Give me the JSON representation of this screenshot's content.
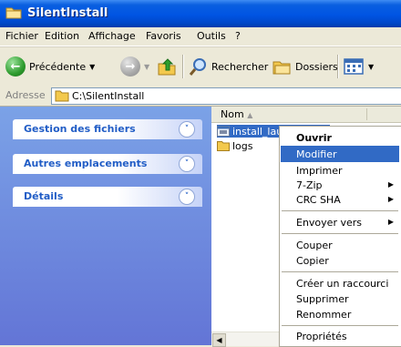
{
  "window": {
    "title": "SilentInstall",
    "title_icon": "folder-icon"
  },
  "menubar": {
    "items": [
      "Fichier",
      "Edition",
      "Affichage",
      "Favoris",
      "Outils",
      "?"
    ]
  },
  "toolbar": {
    "back_label": "Précédente",
    "search_label": "Rechercher",
    "folders_label": "Dossiers"
  },
  "address": {
    "label": "Adresse",
    "value": "C:\\SilentInstall"
  },
  "taskpane": {
    "panels": [
      "Gestion des fichiers",
      "Autres emplacements",
      "Détails"
    ]
  },
  "filelist": {
    "column_name": "Nom",
    "files": [
      {
        "name": "install_launcher.bat",
        "icon": "batch-file-icon",
        "selected": true
      },
      {
        "name": "logs",
        "icon": "folder-icon",
        "selected": false
      }
    ]
  },
  "context_menu": {
    "items": [
      {
        "label": "Ouvrir",
        "bold": true
      },
      {
        "label": "Modifier",
        "highlighted": true
      },
      {
        "label": "Imprimer"
      },
      {
        "label": "7-Zip",
        "submenu": true
      },
      {
        "label": "CRC SHA",
        "submenu": true
      },
      {
        "label": "Envoyer vers",
        "submenu": true
      },
      {
        "label": "Couper"
      },
      {
        "label": "Copier"
      },
      {
        "label": "Créer un raccourci"
      },
      {
        "label": "Supprimer"
      },
      {
        "label": "Renommer"
      },
      {
        "label": "Propriétés"
      }
    ]
  }
}
